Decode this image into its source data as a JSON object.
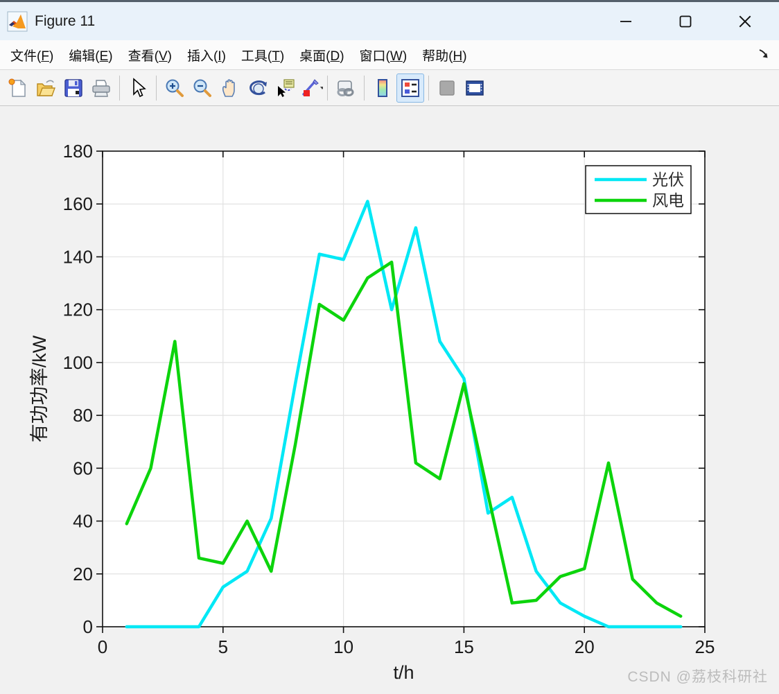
{
  "titlebar": {
    "title": "Figure 11",
    "app_icon": "matlab-logo",
    "controls": {
      "minimize": "minimize",
      "maximize": "maximize",
      "close": "close"
    }
  },
  "menubar": {
    "items": [
      "文件(F)",
      "编辑(E)",
      "查看(V)",
      "插入(I)",
      "工具(T)",
      "桌面(D)",
      "窗口(W)",
      "帮助(H)"
    ],
    "dock_arrow_icon": "dock-arrow-icon"
  },
  "toolbar": {
    "buttons": [
      {
        "name": "new-figure-icon",
        "active": false
      },
      {
        "name": "open-file-icon",
        "active": false
      },
      {
        "name": "save-figure-icon",
        "active": false
      },
      {
        "name": "print-figure-icon",
        "active": false
      },
      {
        "name": "edit-plot-pointer-icon",
        "active": false
      },
      {
        "name": "zoom-in-icon",
        "active": false
      },
      {
        "name": "zoom-out-icon",
        "active": false
      },
      {
        "name": "pan-hand-icon",
        "active": false
      },
      {
        "name": "rotate-3d-icon",
        "active": false
      },
      {
        "name": "data-cursor-icon",
        "active": false
      },
      {
        "name": "brush-data-icon",
        "active": false
      },
      {
        "name": "link-plot-icon",
        "active": false
      },
      {
        "name": "insert-colorbar-icon",
        "active": false
      },
      {
        "name": "insert-legend-icon",
        "active": true
      },
      {
        "name": "hide-plot-tools-icon",
        "active": false
      },
      {
        "name": "dock-figure-icon",
        "active": false
      }
    ]
  },
  "chart_data": {
    "type": "line",
    "x": [
      1,
      2,
      3,
      4,
      5,
      6,
      7,
      8,
      9,
      10,
      11,
      12,
      13,
      14,
      15,
      16,
      17,
      18,
      19,
      20,
      21,
      22,
      23,
      24
    ],
    "series": [
      {
        "name": "光伏",
        "color": "#00e8f5",
        "values": [
          0,
          0,
          0,
          0,
          15,
          21,
          41,
          92,
          141,
          139,
          161,
          120,
          151,
          108,
          94,
          43,
          49,
          21,
          9,
          4,
          0,
          0,
          0,
          0
        ]
      },
      {
        "name": "风电",
        "color": "#0cd40c",
        "values": [
          39,
          60,
          108,
          26,
          24,
          40,
          21,
          69,
          122,
          116,
          132,
          138,
          62,
          56,
          92,
          50,
          9,
          10,
          19,
          22,
          62,
          18,
          9,
          4
        ]
      }
    ],
    "xlabel": "t/h",
    "ylabel": "有功功率/kW",
    "xlim": [
      0,
      25
    ],
    "ylim": [
      0,
      180
    ],
    "xticks": [
      0,
      5,
      10,
      15,
      20,
      25
    ],
    "yticks": [
      0,
      20,
      40,
      60,
      80,
      100,
      120,
      140,
      160,
      180
    ],
    "grid": true,
    "legend_position": "top-right"
  },
  "watermark": {
    "text": "CSDN @荔枝科研社"
  }
}
